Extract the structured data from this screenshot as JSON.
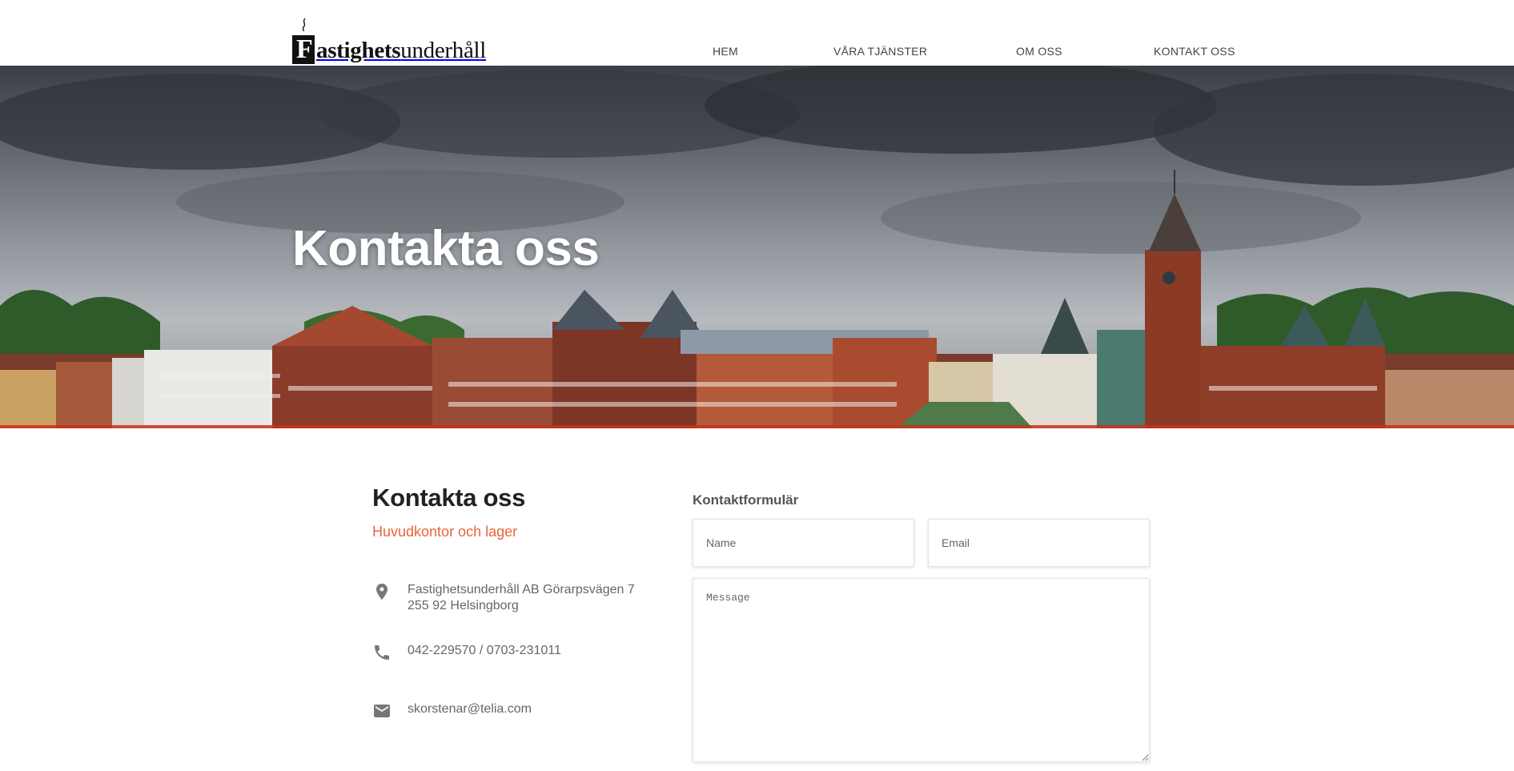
{
  "brand": {
    "logo_letter": "F",
    "logo_bold": "astighets",
    "logo_regular": "underhåll"
  },
  "nav": {
    "items": [
      "HEM",
      "VÅRA TJÄNSTER",
      "OM OSS",
      "KONTAKT OSS"
    ]
  },
  "hero": {
    "title": "Kontakta oss"
  },
  "contact": {
    "title": "Kontakta oss",
    "subtitle": "Huvudkontor och lager",
    "address_line1": "Fastighetsunderhåll AB Görarpsvägen 7",
    "address_line2": "255 92 Helsingborg",
    "phone": "042-229570 / 0703-231011",
    "email": "skorstenar@telia.com"
  },
  "form": {
    "title": "Kontaktformulär",
    "name_placeholder": "Name",
    "email_placeholder": "Email",
    "message_placeholder": "Message"
  },
  "colors": {
    "accent": "#e8643c",
    "hero_line": "#c8321a",
    "icon": "#777777"
  }
}
